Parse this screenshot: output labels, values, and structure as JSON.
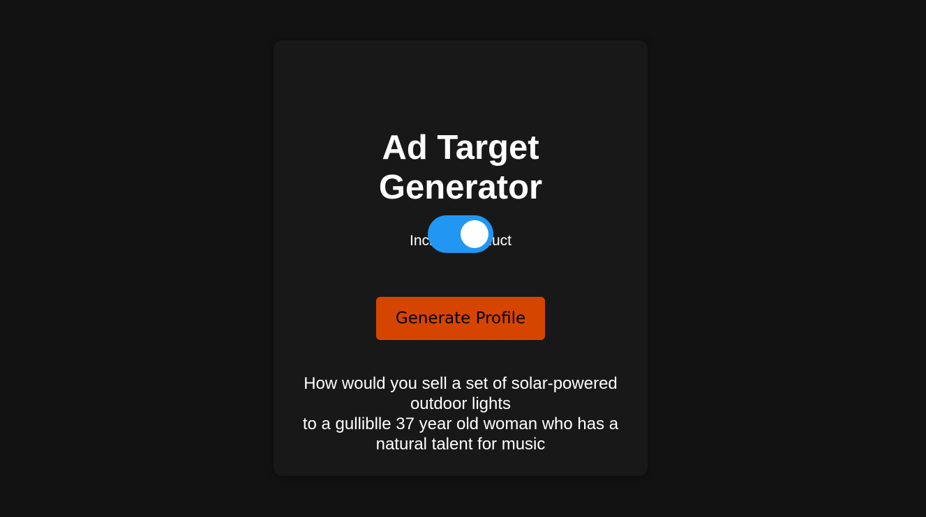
{
  "title_lines": [
    "Ad Target",
    "Generator"
  ],
  "toggle": {
    "label": "Include Product",
    "checked": true
  },
  "generate_button": "Generate Profile",
  "result_lines": [
    "How would you sell a set of solar-powered outdoor lights",
    "to a gulliblle 37 year old woman who has a natural talent for music"
  ],
  "colors": {
    "background": "#121212",
    "card": "#181818",
    "toggle_on": "#2196f3",
    "button": "#d64500"
  }
}
